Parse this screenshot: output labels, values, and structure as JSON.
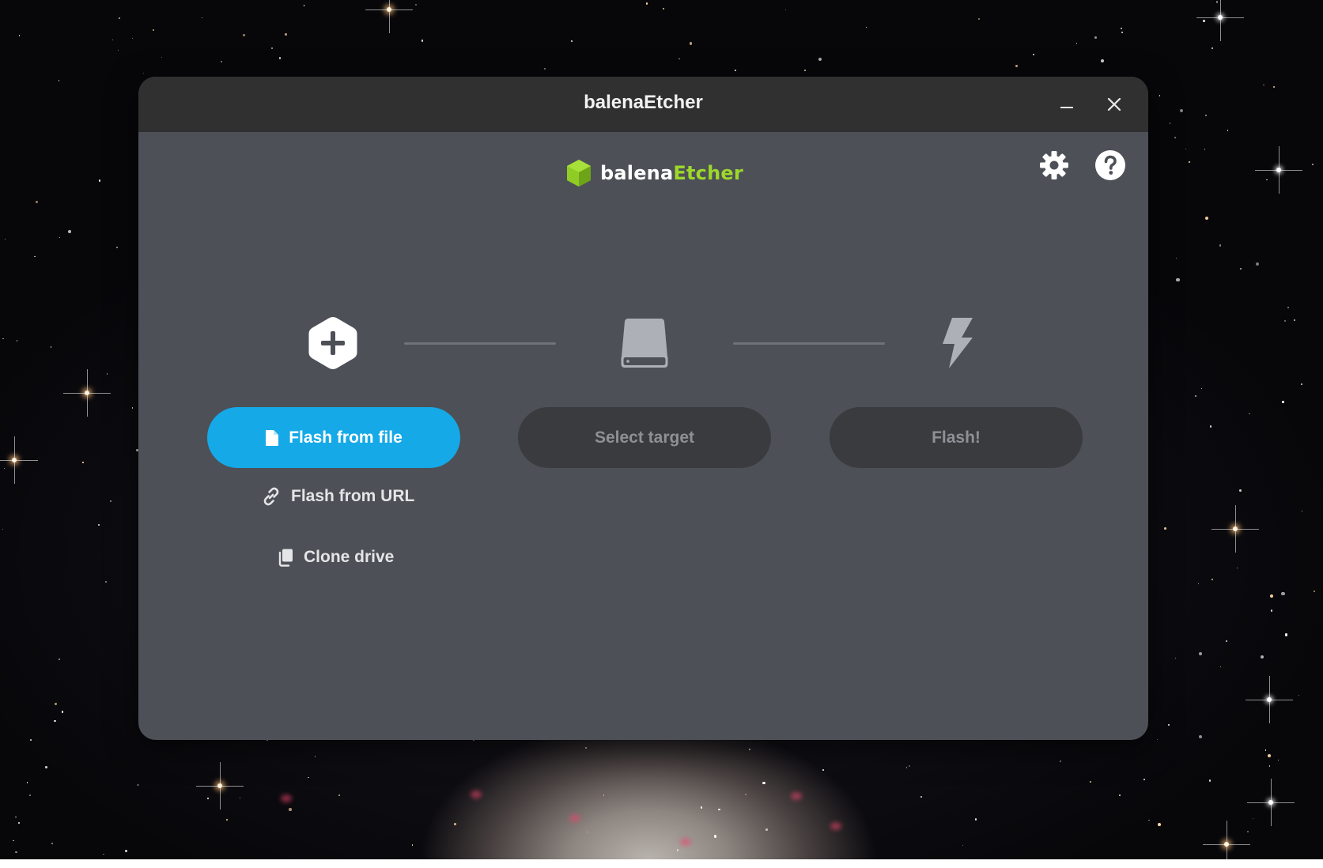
{
  "window": {
    "title": "balenaEtcher",
    "controls": [
      "minimize-icon",
      "close-icon"
    ]
  },
  "header": {
    "brand_part1": "balena",
    "brand_part2": "Etcher",
    "brand_color": "#9dd82a",
    "icons": [
      "gear-icon",
      "help-icon"
    ]
  },
  "steps": {
    "icons": [
      "plus-hexagon-icon",
      "drive-icon",
      "lightning-icon"
    ],
    "flash_from_file": "Flash from file",
    "select_target": "Select target",
    "flash": "Flash!",
    "flash_from_url": "Flash from URL",
    "clone_drive": "Clone drive"
  },
  "colors": {
    "accent": "#15a9e8",
    "window_bg": "#4d5057",
    "titlebar_bg": "#303030",
    "disabled_button_bg": "#3a3b3f",
    "disabled_text": "#8e9096"
  }
}
